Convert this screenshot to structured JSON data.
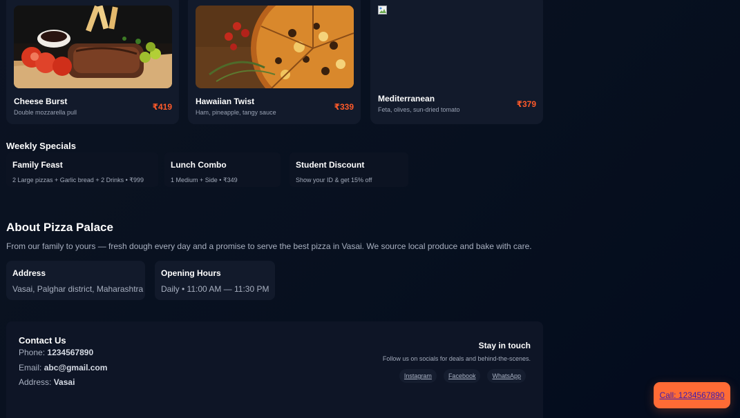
{
  "menu": {
    "items": [
      {
        "name": "Cheese Burst",
        "desc": "Double mozzarella pull",
        "price": "₹419"
      },
      {
        "name": "Hawaiian Twist",
        "desc": "Ham, pineapple, tangy sauce",
        "price": "₹339"
      },
      {
        "name": "Mediterranean",
        "desc": "Feta, olives, sun-dried tomato",
        "price": "₹379"
      }
    ]
  },
  "specials": {
    "title": "Weekly Specials",
    "items": [
      {
        "title": "Family Feast",
        "desc": "2 Large pizzas + Garlic bread + 2 Drinks • ₹999"
      },
      {
        "title": "Lunch Combo",
        "desc": "1 Medium + Side • ₹349"
      },
      {
        "title": "Student Discount",
        "desc": "Show your ID & get 15% off"
      }
    ]
  },
  "about": {
    "title": "About Pizza Palace",
    "text": "From our family to yours — fresh dough every day and a promise to serve the best pizza in Vasai. We source local produce and bake with care.",
    "address_label": "Address",
    "address_value": "Vasai, Palghar district, Maharashtra",
    "hours_label": "Opening Hours",
    "hours_value": "Daily • 11:00 AM — 11:30 PM"
  },
  "contact": {
    "title": "Contact Us",
    "phone_label": "Phone:",
    "phone": "1234567890",
    "email_label": "Email:",
    "email": "abc@gmail.com",
    "address_label": "Address:",
    "address": "Vasai",
    "stay_title": "Stay in touch",
    "follow_text": "Follow us on socials for deals and behind-the-scenes.",
    "socials": [
      "Instagram",
      "Facebook",
      "WhatsApp"
    ]
  },
  "call_button": "Call: 1234567890",
  "colors": {
    "accent": "#ff6b35",
    "price": "#ff5a2a",
    "card": "#121a2b",
    "background": "#07101f"
  }
}
